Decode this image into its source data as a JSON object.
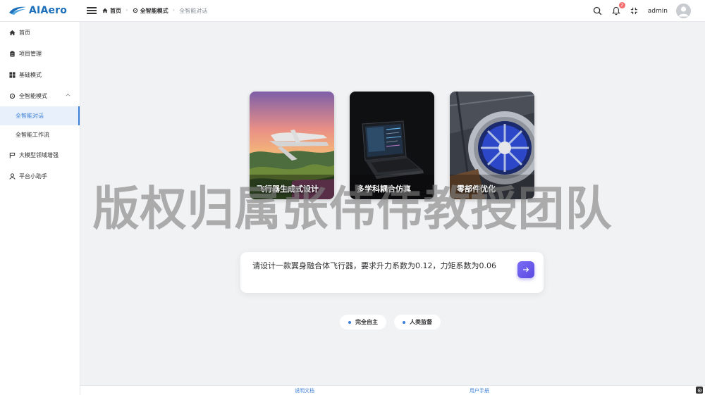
{
  "app": {
    "logo_text": "AIAero"
  },
  "breadcrumb": [
    {
      "label": "首页",
      "icon": "home-icon"
    },
    {
      "label": "全智能模式",
      "icon": "gear-icon"
    },
    {
      "label": "全智能对话"
    }
  ],
  "header": {
    "notification_count": "2",
    "user_name": "admin"
  },
  "sidebar": {
    "items": [
      {
        "label": "首页",
        "icon": "home-icon"
      },
      {
        "label": "项目管理",
        "icon": "clipboard-icon"
      },
      {
        "label": "基础模式",
        "icon": "grid-icon"
      },
      {
        "label": "全智能模式",
        "icon": "gear-icon",
        "expanded": true
      }
    ],
    "sub_items": [
      {
        "label": "全智能对话",
        "active": true
      },
      {
        "label": "全智能工作流",
        "active": false
      }
    ],
    "items_after": [
      {
        "label": "大模型领域增强",
        "icon": "flag-icon"
      },
      {
        "label": "平台小助手",
        "icon": "user-icon"
      }
    ]
  },
  "cards": [
    {
      "title": "飞行器生成式设计",
      "image": "aircraft-image"
    },
    {
      "title": "多学科耦合仿真",
      "image": "laptop-image"
    },
    {
      "title": "零部件优化",
      "image": "engine-image"
    }
  ],
  "watermark": "版权归属张伟伟教授团队",
  "chat": {
    "input_value": "请设计一款翼身融合体飞行器，要求升力系数为0.12，力矩系数为0.06"
  },
  "modes": [
    {
      "label": "完全自主"
    },
    {
      "label": "人类监督"
    }
  ],
  "footer": {
    "docs_label": "说明文档",
    "manual_label": "用户手册"
  },
  "colors": {
    "accent": "#3d7fd8",
    "logo": "#1c6fb8",
    "send": "#6a5bf0"
  }
}
